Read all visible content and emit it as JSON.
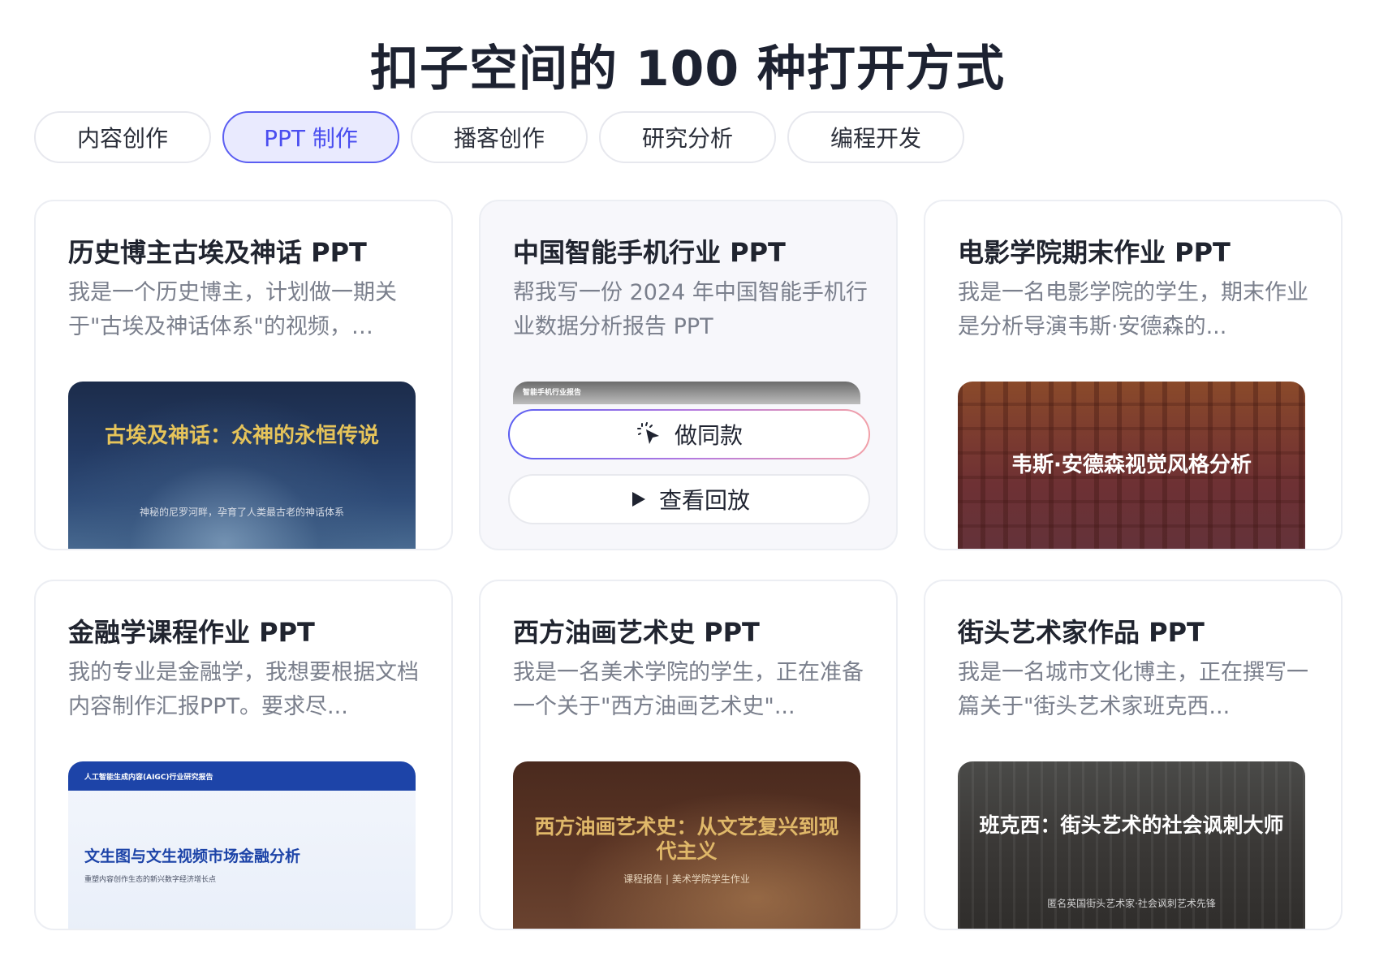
{
  "page_title": "扣子空间的 100 种打开方式",
  "tabs": [
    {
      "label": "内容创作",
      "active": false
    },
    {
      "label": "PPT 制作",
      "active": true
    },
    {
      "label": "播客创作",
      "active": false
    },
    {
      "label": "研究分析",
      "active": false
    },
    {
      "label": "编程开发",
      "active": false
    }
  ],
  "accent_color": "#5b5ef2",
  "cards": [
    {
      "title": "历史博主古埃及神话 PPT",
      "desc": "我是一个历史博主，计划做一期关于\"古埃及神话体系\"的视频，…",
      "thumb_title": "古埃及神话：众神的永恒传说",
      "thumb_sub": "神秘的尼罗河畔，孕育了人类最古老的神话体系"
    },
    {
      "title": "中国智能手机行业 PPT",
      "desc": "帮我写一份 2024 年中国智能手机行业数据分析报告 PPT",
      "thumb_header": "智能手机行业报告",
      "make_same_label": "做同款",
      "replay_label": "查看回放"
    },
    {
      "title": "电影学院期末作业 PPT",
      "desc": "我是一名电影学院的学生，期末作业是分析导演韦斯·安德森的...",
      "thumb_title": "韦斯·安德森视觉风格分析"
    },
    {
      "title": "金融学课程作业 PPT",
      "desc": "我的专业是金融学，我想要根据文档内容制作汇报PPT。要求尽...",
      "thumb_header": "人工智能生成内容(AIGC)行业研究报告",
      "thumb_title": "文生图与文生视频市场金融分析",
      "thumb_sub": "重塑内容创作生态的新兴数字经济增长点"
    },
    {
      "title": "西方油画艺术史 PPT",
      "desc": "我是一名美术学院的学生，正在准备一个关于\"西方油画艺术史\"...",
      "thumb_title": "西方油画艺术史：从文艺复兴到现代主义",
      "thumb_sub": "课程报告 | 美术学院学生作业"
    },
    {
      "title": "街头艺术家作品 PPT",
      "desc": "我是一名城市文化博主，正在撰写一篇关于\"街头艺术家班克西...",
      "thumb_title": "班克西：街头艺术的社会讽刺大师",
      "thumb_sub": "匿名英国街头艺术家·社会讽刺艺术先锋"
    }
  ]
}
